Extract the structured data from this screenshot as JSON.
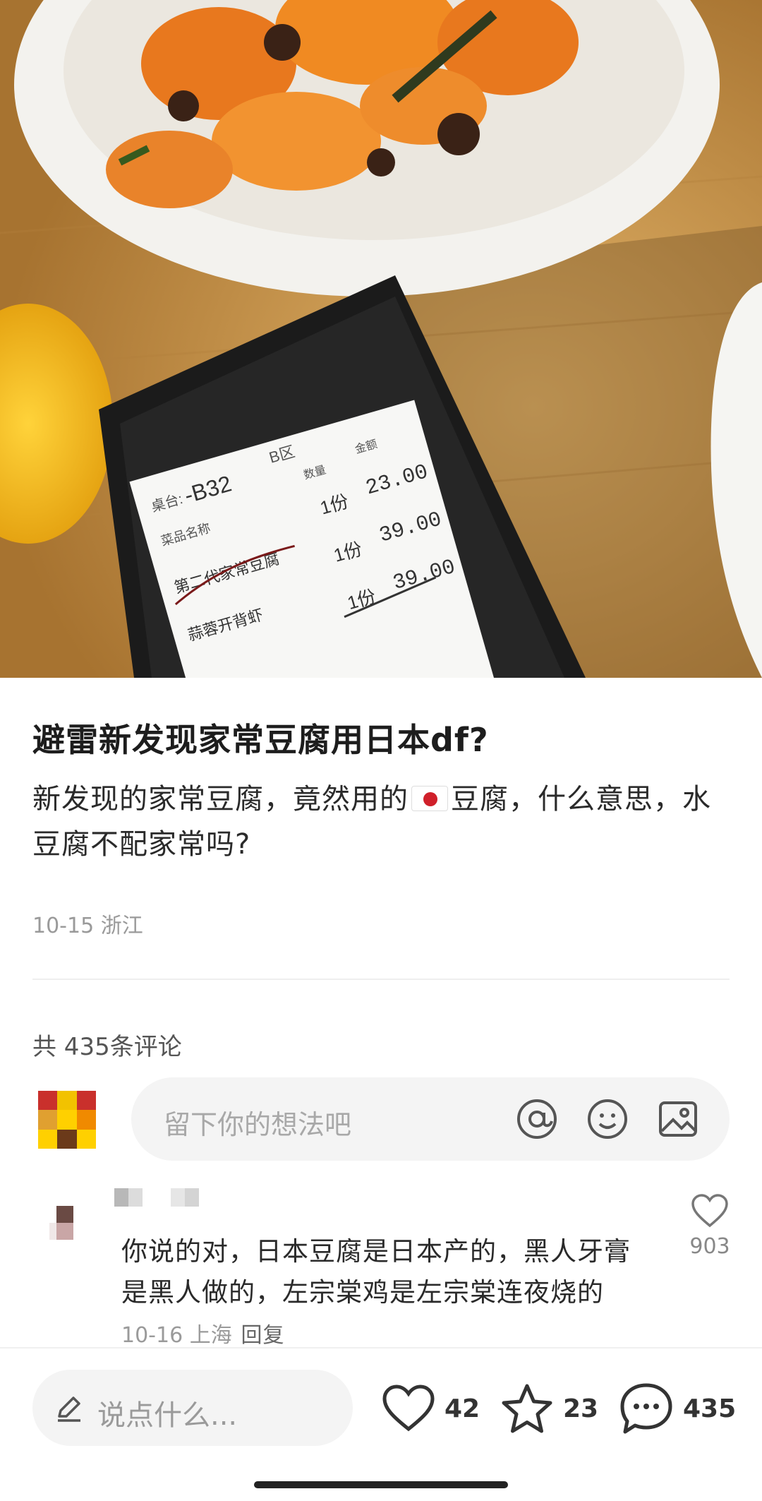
{
  "post": {
    "title": "避雷新发现家常豆腐用日本df?",
    "body_before_flag": "新发现的家常豆腐，竟然用的",
    "flag_icon": "japan-flag-emoji",
    "body_after_flag": "豆腐，什么意思，水豆腐不配家常吗?",
    "meta": "10-15 浙江"
  },
  "receipt": {
    "table_label": "桌台:",
    "table_no": "-B32",
    "zone": "B区",
    "col_qty": "数量",
    "col_amount": "金额",
    "col_item": "菜品名称",
    "rows": [
      {
        "item": "第二代家常豆腐",
        "qty": "1份",
        "amount": "23.00"
      },
      {
        "item": "",
        "qty": "1份",
        "amount": "39.00"
      },
      {
        "item": "蒜蓉开背虾",
        "qty": "1份",
        "amount": "39.00"
      }
    ]
  },
  "comments": {
    "count_label": "共 435条评论",
    "input_placeholder": "留下你的想法吧",
    "input_icons": [
      "at-icon",
      "emoji-icon",
      "image-icon"
    ],
    "items": [
      {
        "text": "你说的对，日本豆腐是日本产的，黑人牙膏是黑人做的，左宗棠鸡是左宗棠连夜烧的",
        "date": "10-16 上海",
        "reply_label": "回复",
        "likes": "903"
      }
    ]
  },
  "bottom_bar": {
    "placeholder": "说点什么...",
    "likes": "42",
    "favorites": "23",
    "comments": "435"
  },
  "colors": {
    "accent_flag_red": "#d0202a",
    "text_primary": "#1d1d1d",
    "text_muted": "#9a9a9a",
    "input_bg": "#f4f4f4"
  }
}
